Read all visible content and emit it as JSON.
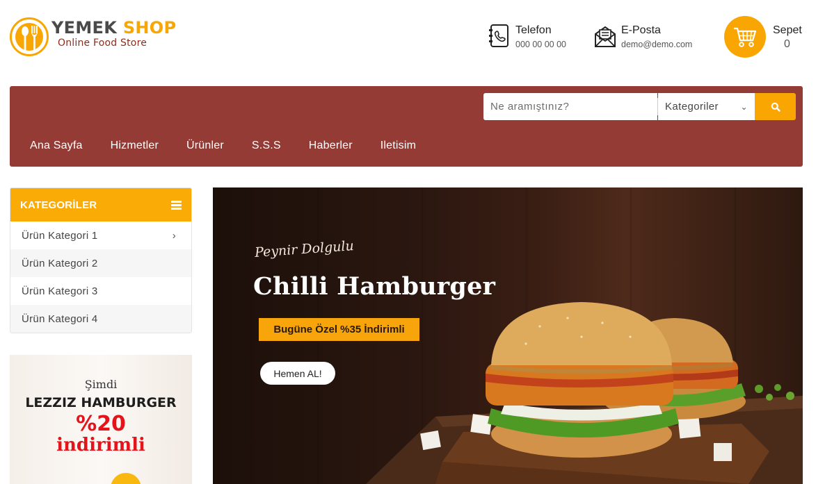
{
  "brand": {
    "name_part1": "YEMEK",
    "name_part2": "SHOP",
    "tagline": "Online Food Store",
    "primary_color": "#f9a602",
    "accent_color": "#943b35"
  },
  "header": {
    "phone": {
      "icon": "phone-book-icon",
      "label": "Telefon",
      "value": "000 00 00 00"
    },
    "email": {
      "icon": "envelope-icon",
      "label": "E-Posta",
      "value": "demo@demo.com"
    },
    "cart": {
      "icon": "shopping-cart-icon",
      "label": "Sepet",
      "count": "0"
    }
  },
  "search": {
    "placeholder": "Ne aramıştınız?",
    "category_label": "Kategoriler",
    "button_icon": "search-icon"
  },
  "nav": {
    "items": [
      {
        "label": "Ana Sayfa"
      },
      {
        "label": "Hizmetler"
      },
      {
        "label": "Ürünler"
      },
      {
        "label": "S.S.S"
      },
      {
        "label": "Haberler"
      },
      {
        "label": "Iletisim"
      }
    ]
  },
  "sidebar": {
    "title": "KATEGORİLER",
    "title_icon": "menu-bars-icon",
    "items": [
      {
        "label": "Ürün Kategori 1",
        "has_children": true
      },
      {
        "label": "Ürün Kategori 2"
      },
      {
        "label": "Ürün Kategori 3"
      },
      {
        "label": "Ürün Kategori 4"
      }
    ],
    "promo": {
      "line1": "Şimdi",
      "line2": "LEZZIZ HAMBURGER",
      "line3": "%20",
      "line4": "indirimli"
    }
  },
  "hero": {
    "kicker": "Peynir Dolgulu",
    "title": "Chilli Hamburger",
    "badge": "Bugüne Özel %35 İndirimli",
    "cta": "Hemen AL!"
  }
}
